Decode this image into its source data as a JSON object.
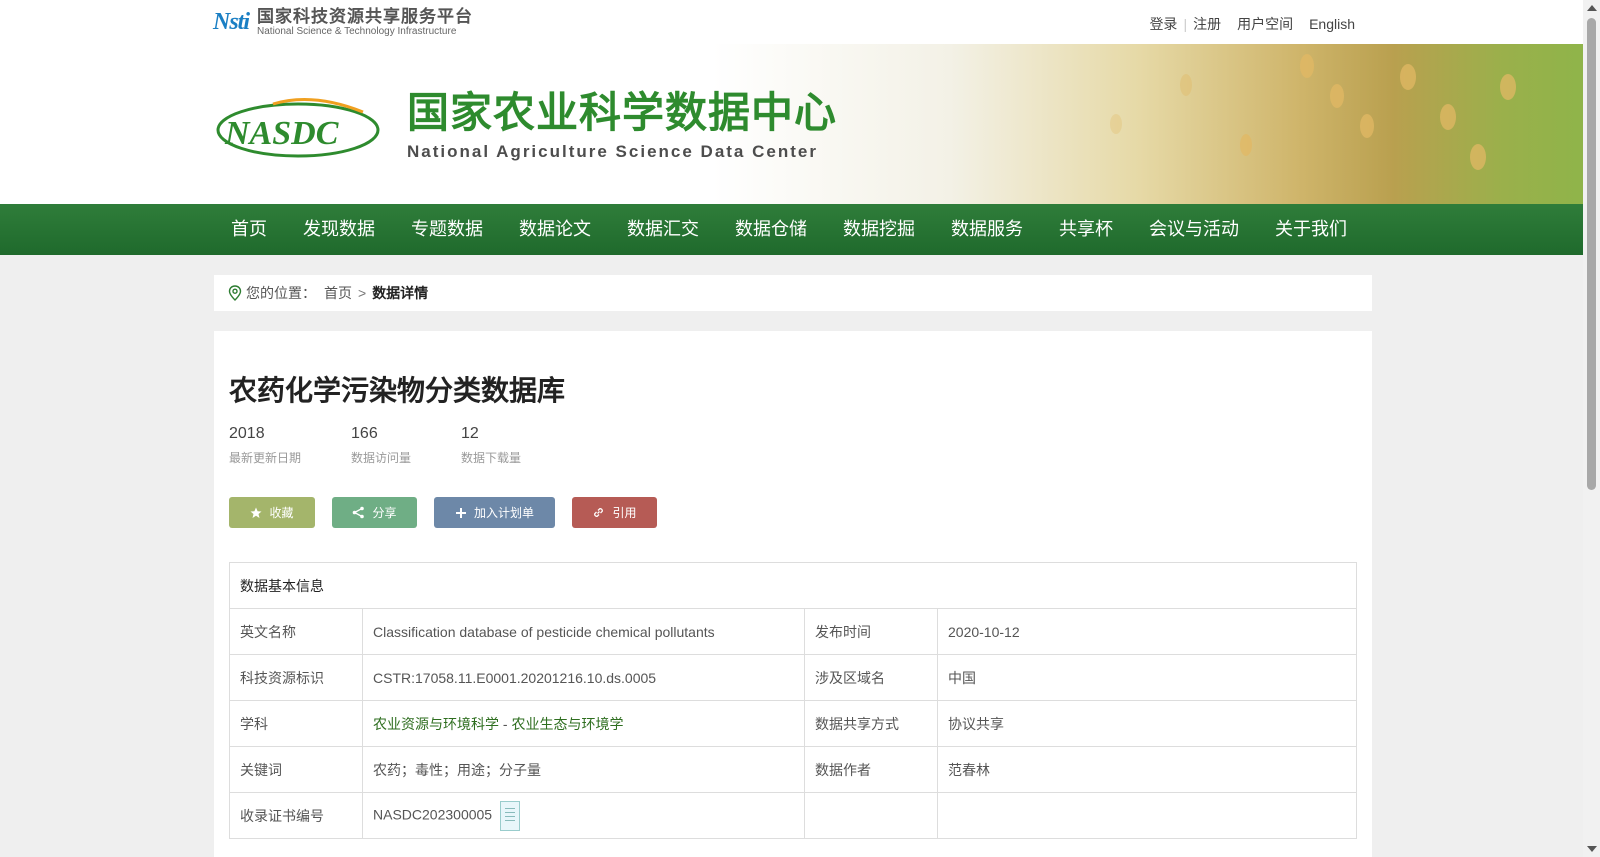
{
  "header": {
    "nsti_mark": "Nsti",
    "nsti_cn": "国家科技资源共享服务平台",
    "nsti_en": "National Science & Technology Infrastructure",
    "links": {
      "login": "登录",
      "register": "注册",
      "user_space": "用户空间",
      "english": "English"
    }
  },
  "banner": {
    "logo_text": "NASDC",
    "title_cn": "国家农业科学数据中心",
    "title_en": "National Agriculture Science Data Center"
  },
  "nav": [
    "首页",
    "发现数据",
    "专题数据",
    "数据论文",
    "数据汇交",
    "数据仓储",
    "数据挖掘",
    "数据服务",
    "共享杯",
    "会议与活动",
    "关于我们"
  ],
  "breadcrumb": {
    "prefix": "您的位置：",
    "home": "首页",
    "sep": ">",
    "current": "数据详情"
  },
  "dataset": {
    "title": "农药化学污染物分类数据库",
    "stats": [
      {
        "value": "2018",
        "label": "最新更新日期"
      },
      {
        "value": "166",
        "label": "数据访问量"
      },
      {
        "value": "12",
        "label": "数据下载量"
      }
    ],
    "actions": {
      "favorite": "收藏",
      "share": "分享",
      "add_plan": "加入计划单",
      "cite": "引用"
    }
  },
  "table": {
    "heading": "数据基本信息",
    "rows": [
      {
        "k1": "英文名称",
        "v1": "Classification database of pesticide chemical pollutants",
        "k2": "发布时间",
        "v2": "2020-10-12"
      },
      {
        "k1": "科技资源标识",
        "v1": "CSTR:17058.11.E0001.20201216.10.ds.0005",
        "k2": "涉及区域名",
        "v2": "中国"
      },
      {
        "k1": "学科",
        "v1a": "农业资源与环境科学",
        "v1sep": " - ",
        "v1b": "农业生态与环境学",
        "k2": "数据共享方式",
        "v2": "协议共享"
      },
      {
        "k1": "关键词",
        "v1": "农药；毒性；用途；分子量",
        "k2": "数据作者",
        "v2": "范春林"
      },
      {
        "k1": "收录证书编号",
        "v1": "NASDC202300005",
        "k2": "",
        "v2": ""
      }
    ]
  },
  "colors": {
    "nav_green": "#2f7d3a",
    "brand_green": "#2e8b2e",
    "link_green": "#2e6e1f",
    "fav": "#a4b56b",
    "share": "#6fae85",
    "plan": "#6d88a8",
    "cite": "#b65b55"
  }
}
